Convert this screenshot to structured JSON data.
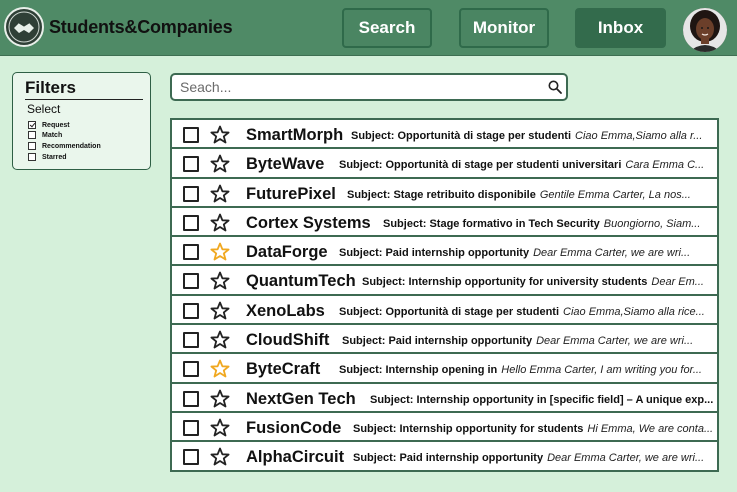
{
  "app": {
    "name": "Students&Companies",
    "logo_icon": "handshake-icon",
    "colors": {
      "header": "#4f8a66",
      "background": "#d5f0da",
      "accent": "#2f6a4a",
      "star_active": "#f0a820"
    }
  },
  "nav": {
    "search_label": "Search",
    "monitor_label": "Monitor",
    "inbox_label": "Inbox",
    "active": "Inbox"
  },
  "filters": {
    "title": "Filters",
    "select_label": "Select",
    "options": [
      {
        "label": "Request",
        "checked": true
      },
      {
        "label": "Match",
        "checked": false
      },
      {
        "label": "Recommendation",
        "checked": false
      },
      {
        "label": "Starred",
        "checked": false
      }
    ]
  },
  "search": {
    "placeholder": "Seach...",
    "icon": "search-icon"
  },
  "mails": [
    {
      "company": "SmartMorph",
      "subject": "Subject: Opportunità di stage per studenti",
      "preview": "Ciao Emma,Siamo alla r...",
      "starred": false
    },
    {
      "company": "ByteWave",
      "subject": "Subject: Opportunità di stage per studenti universitari",
      "preview": "Cara Emma C...",
      "starred": false
    },
    {
      "company": "FuturePixel",
      "subject": "Subject: Stage retribuito disponibile",
      "preview": "Gentile Emma Carter, La nos...",
      "starred": false
    },
    {
      "company": "Cortex Systems",
      "subject": "Subject: Stage formativo in Tech Security",
      "preview": "Buongiorno, Siam...",
      "starred": false
    },
    {
      "company": "DataForge",
      "subject": "Subject: Paid internship opportunity",
      "preview": "Dear Emma Carter, we are wri...",
      "starred": true
    },
    {
      "company": "QuantumTech",
      "subject": "Subject: Internship opportunity for university students",
      "preview": "Dear Em...",
      "starred": false
    },
    {
      "company": "XenoLabs",
      "subject": "Subject: Opportunità di stage per studenti",
      "preview": "Ciao Emma,Siamo alla rice...",
      "starred": false
    },
    {
      "company": "CloudShift",
      "subject": "Subject: Paid internship opportunity",
      "preview": "Dear Emma Carter, we are wri...",
      "starred": false
    },
    {
      "company": "ByteCraft",
      "subject": "Subject: Internship opening in",
      "preview": "Hello Emma Carter, I am writing you for...",
      "starred": true
    },
    {
      "company": "NextGen Tech",
      "subject": "Subject: Internship opportunity in [specific field] – A unique exp...",
      "preview": "",
      "starred": false
    },
    {
      "company": "FusionCode",
      "subject": "Subject: Internship opportunity for students",
      "preview": "Hi Emma, We are conta...",
      "starred": false
    },
    {
      "company": "AlphaCircuit",
      "subject": "Subject: Paid internship opportunity",
      "preview": "Dear Emma Carter, we are wri...",
      "starred": false
    }
  ]
}
